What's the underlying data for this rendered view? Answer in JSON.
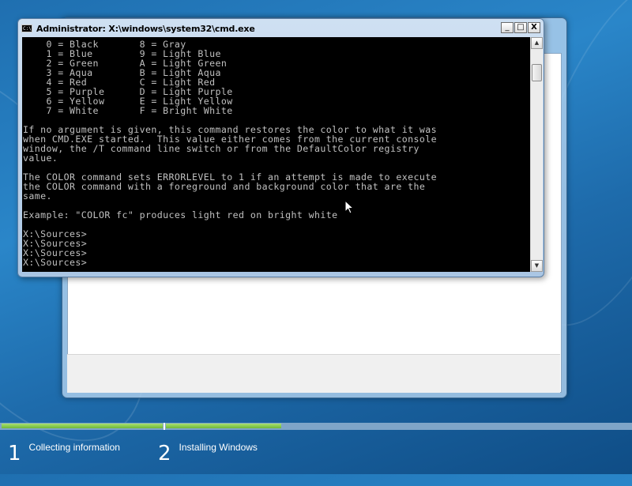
{
  "console": {
    "title": "Administrator: X:\\windows\\system32\\cmd.exe",
    "icon_label": "C:\\",
    "lines": [
      "    0 = Black       8 = Gray",
      "    1 = Blue        9 = Light Blue",
      "    2 = Green       A = Light Green",
      "    3 = Aqua        B = Light Aqua",
      "    4 = Red         C = Light Red",
      "    5 = Purple      D = Light Purple",
      "    6 = Yellow      E = Light Yellow",
      "    7 = White       F = Bright White",
      "",
      "If no argument is given, this command restores the color to what it was",
      "when CMD.EXE started.  This value either comes from the current console",
      "window, the /T command line switch or from the DefaultColor registry",
      "value.",
      "",
      "The COLOR command sets ERRORLEVEL to 1 if an attempt is made to execute",
      "the COLOR command with a foreground and background color that are the",
      "same.",
      "",
      "Example: \"COLOR fc\" produces light red on bright white",
      "",
      "X:\\Sources>",
      "X:\\Sources>",
      "X:\\Sources>",
      "X:\\Sources>"
    ],
    "buttons": {
      "minimize": "_",
      "maximize": "□",
      "close": "X"
    },
    "scroll_up": "▲",
    "scroll_down": "▼",
    "text_color": "#c0c0c0",
    "background_color": "#000000"
  },
  "setup": {
    "steps": [
      {
        "number": "1",
        "label": "Collecting information"
      },
      {
        "number": "2",
        "label": "Installing Windows"
      }
    ],
    "progress_color": "#7dc94a"
  }
}
